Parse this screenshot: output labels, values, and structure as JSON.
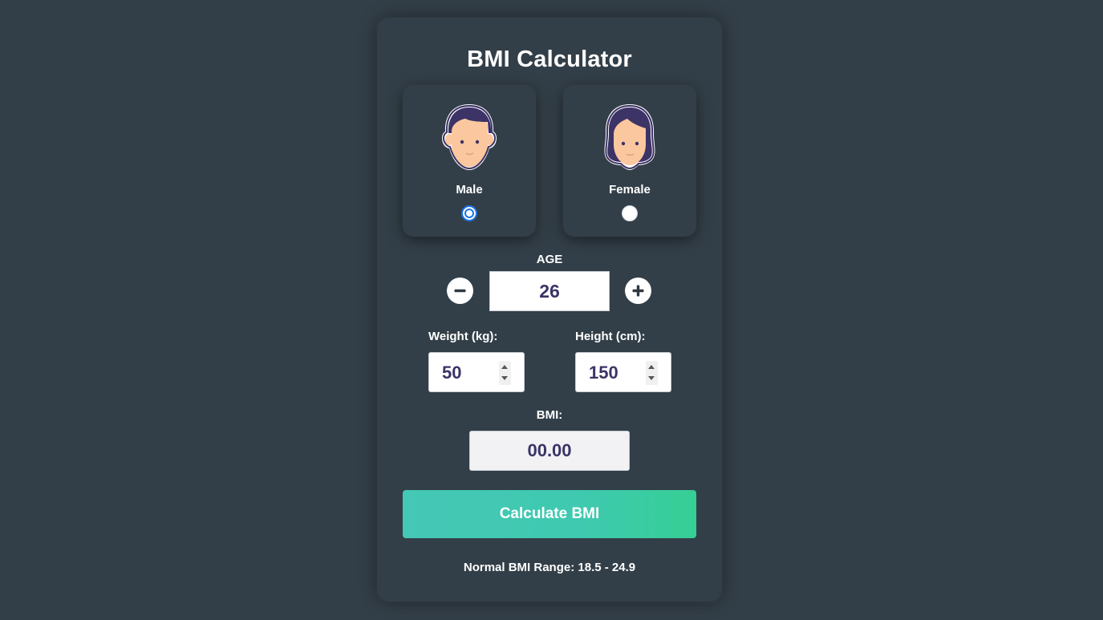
{
  "title": "BMI Calculator",
  "gender": {
    "options": [
      {
        "label": "Male",
        "icon": "male-avatar-icon",
        "checked": true
      },
      {
        "label": "Female",
        "icon": "female-avatar-icon",
        "checked": false
      }
    ]
  },
  "age": {
    "label": "AGE",
    "value": "26",
    "decrement_icon": "minus-icon",
    "increment_icon": "plus-icon"
  },
  "weight": {
    "label": "Weight (kg):",
    "value": "50"
  },
  "height": {
    "label": "Height (cm):",
    "value": "150"
  },
  "bmi": {
    "label": "BMI:",
    "value": "00.00"
  },
  "calculate_button": "Calculate BMI",
  "normal_range": "Normal BMI Range: 18.5 - 24.9",
  "colors": {
    "background": "#333f48",
    "accent_start": "#45c8b6",
    "accent_end": "#36cf95",
    "value_text": "#3a3466",
    "radio_checked": "#1a73e8",
    "avatar_hair": "#3c3366",
    "avatar_skin": "#fbc79e"
  }
}
